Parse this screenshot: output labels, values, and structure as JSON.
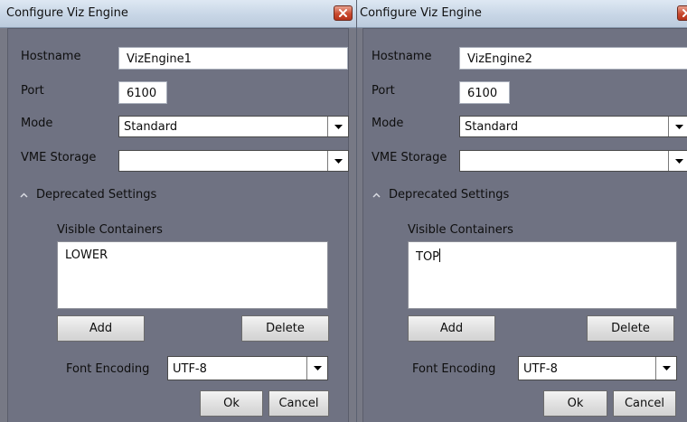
{
  "dialogs": [
    {
      "title": "Configure Viz Engine",
      "hostname_label": "Hostname",
      "hostname_value": "VizEngine1",
      "port_label": "Port",
      "port_value": "6100",
      "mode_label": "Mode",
      "mode_value": "Standard",
      "vme_storage_label": "VME Storage",
      "vme_storage_value": "",
      "deprecated_label": "Deprecated Settings",
      "visible_containers_label": "Visible Containers",
      "visible_containers_value": "LOWER",
      "add_label": "Add",
      "delete_label": "Delete",
      "font_encoding_label": "Font Encoding",
      "font_encoding_value": "UTF-8",
      "ok_label": "Ok",
      "cancel_label": "Cancel"
    },
    {
      "title": "Configure Viz Engine",
      "hostname_label": "Hostname",
      "hostname_value": "VizEngine2",
      "port_label": "Port",
      "port_value": "6100",
      "mode_label": "Mode",
      "mode_value": "Standard",
      "vme_storage_label": "VME Storage",
      "vme_storage_value": "",
      "deprecated_label": "Deprecated Settings",
      "visible_containers_label": "Visible Containers",
      "visible_containers_value": "TOP",
      "add_label": "Add",
      "delete_label": "Delete",
      "font_encoding_label": "Font Encoding",
      "font_encoding_value": "UTF-8",
      "ok_label": "Ok",
      "cancel_label": "Cancel"
    }
  ],
  "colors": {
    "titlebar": "#c8d6e6",
    "dialog_body": "#6f7282",
    "close_button": "#c94a2f"
  }
}
